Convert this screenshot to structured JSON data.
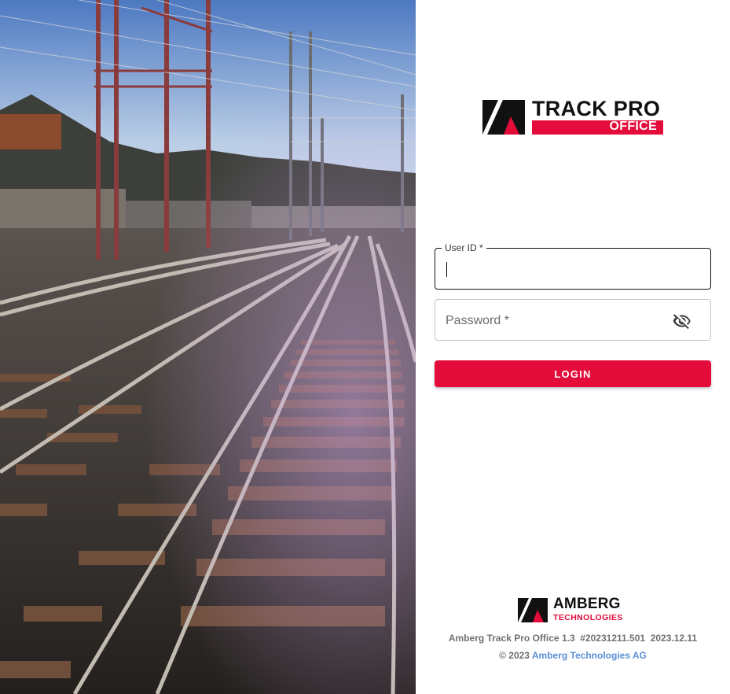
{
  "hero_image": {
    "label": "railway tracks photo",
    "colors": {
      "sky": "#6f9ad2",
      "ballast": "#3a3530",
      "rail": "#b9b2a8",
      "sleeper": "#7a5a44",
      "catenary": "#8a3b3b"
    }
  },
  "brand": {
    "track_word": "TRACK PRO",
    "office_word": "OFFICE",
    "accent": "#e40c3a"
  },
  "form": {
    "user_id_label": "User ID *",
    "user_id_value": "",
    "password_placeholder": "Password *",
    "password_value": "",
    "visibility_icon": "eye-off-icon",
    "login_label": "LOGIN"
  },
  "footer": {
    "company_name": "AMBERG",
    "company_sub": "TECHNOLOGIES",
    "version_text": "Amberg Track Pro Office 1.3  #20231211.501  2023.12.11",
    "copyright_prefix": "© 2023",
    "company_link": "Amberg Technologies AG",
    "link_color": "#5b8fd6"
  }
}
